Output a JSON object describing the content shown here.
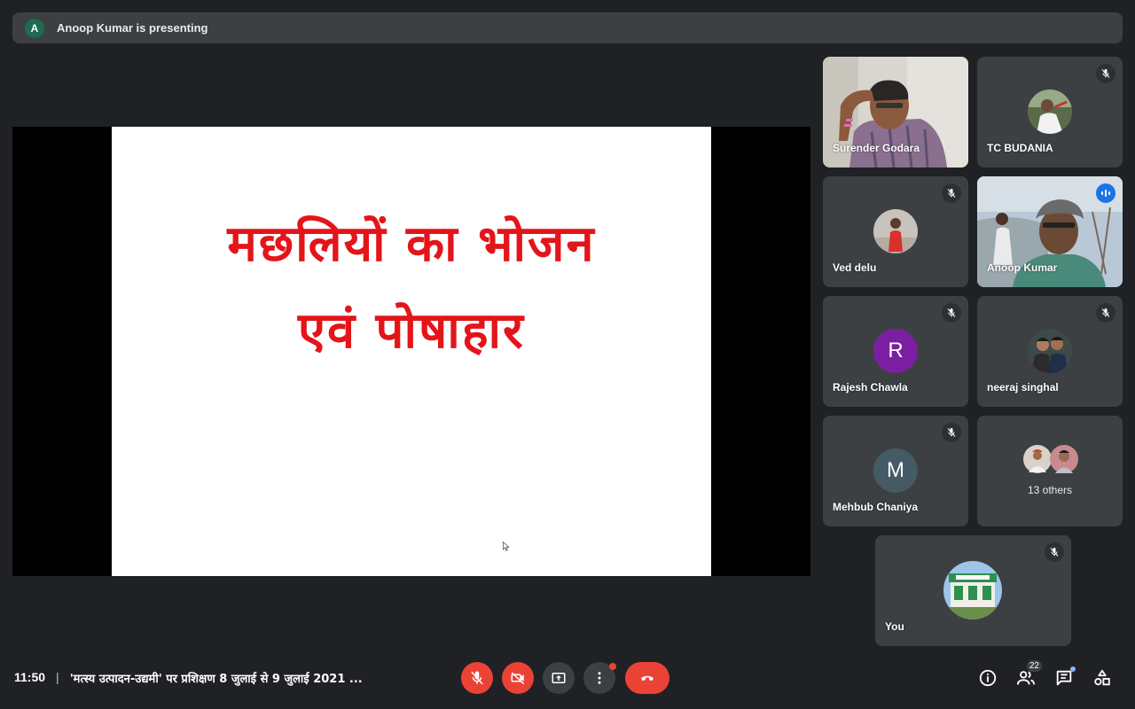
{
  "presenting_banner": {
    "avatar_letter": "A",
    "text": "Anoop Kumar is presenting"
  },
  "slide": {
    "line1": "मछलियों का भोजन",
    "line2": "एवं पोषाहार"
  },
  "participants": [
    {
      "name": "Surender Godara",
      "type": "video"
    },
    {
      "name": "TC BUDANIA",
      "type": "photo",
      "muted": true
    },
    {
      "name": "Ved delu",
      "type": "photo",
      "muted": true
    },
    {
      "name": "Anoop Kumar",
      "type": "video",
      "speaking": true
    },
    {
      "name": "Rajesh Chawla",
      "type": "letter",
      "letter": "R",
      "color": "#7b1fa2",
      "muted": true
    },
    {
      "name": "neeraj singhal",
      "type": "photo",
      "muted": true
    },
    {
      "name": "Mehbub Chaniya",
      "type": "letter",
      "letter": "M",
      "color": "#455a64",
      "muted": true
    },
    {
      "name": "13 others",
      "type": "group"
    },
    {
      "name": "You",
      "type": "photo",
      "muted": true
    }
  ],
  "bottom": {
    "time": "11:50",
    "separator": "|",
    "meeting_title": "'मत्स्य उत्पादन-उद्यमी' पर प्रशिक्षण 8 जुलाई से 9 जुलाई 2021 ...",
    "people_count": "22"
  },
  "icons": {
    "mic": "mic-off-icon",
    "camera": "camera-off-icon",
    "present": "present-now-icon",
    "more": "more-options-icon",
    "end": "end-call-icon",
    "info": "info-icon",
    "people": "people-icon",
    "chat": "chat-icon",
    "activities": "activities-icon"
  },
  "colors": {
    "background": "#202124",
    "tile": "#3c4043",
    "red": "#ea4335",
    "speaking_border": "#8ab4f8",
    "slide_text": "#e3151a"
  }
}
